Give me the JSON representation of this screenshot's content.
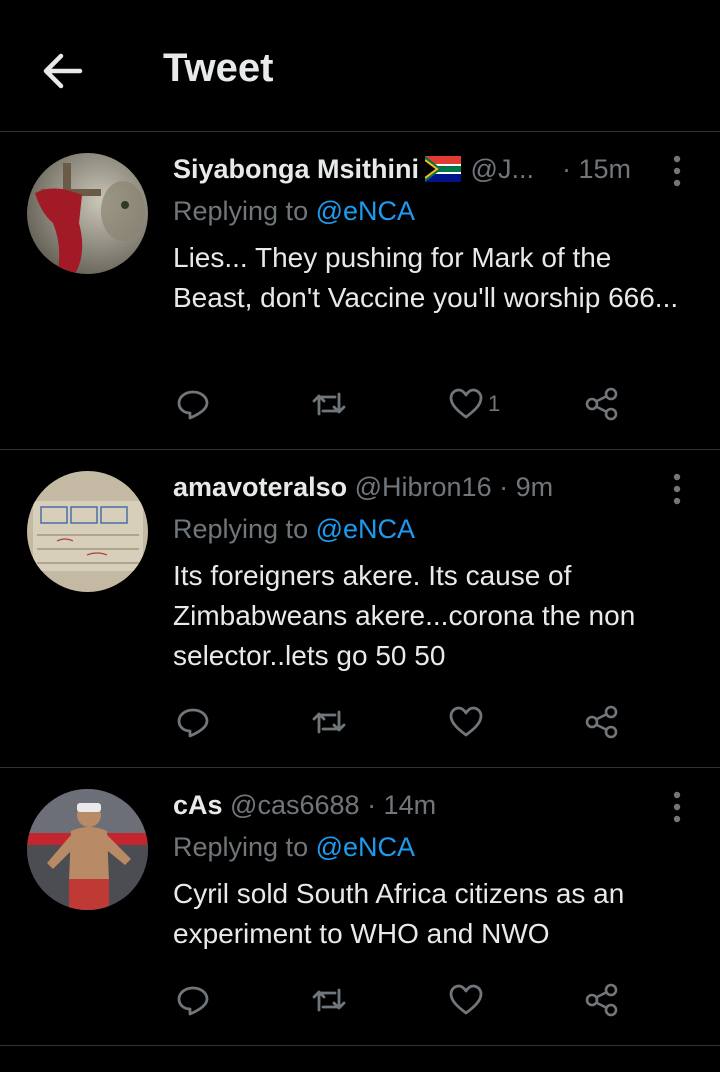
{
  "header": {
    "title": "Tweet",
    "back_icon": "arrow-left-icon"
  },
  "tweets": [
    {
      "name": "Siyabonga Msithini",
      "flag": "south-africa-flag-emoji",
      "handle": "@J...",
      "time": "· 15m",
      "replying_label": "Replying to ",
      "replying_to": "@eNCA",
      "text": "Lies... They pushing for Mark of the Beast, don't Vaccine you'll worship 666...",
      "likes": "1"
    },
    {
      "name": "amavoteralso",
      "handle": "@Hibron16",
      "time": "· 9m",
      "replying_label": "Replying to ",
      "replying_to": "@eNCA",
      "text": "Its foreigners akere. Its cause of Zimbabweans akere...corona the non selector..lets go 50 50",
      "likes": ""
    },
    {
      "name": "cAs",
      "handle": "@cas6688",
      "time": "· 14m",
      "replying_label": "Replying to ",
      "replying_to": "@eNCA",
      "text": "Cyril sold South Africa citizens as an experiment to WHO and NWO",
      "likes": ""
    }
  ],
  "colors": {
    "background": "#000000",
    "text": "#e7e9ea",
    "muted": "#71767b",
    "link": "#1d9bf0",
    "divider": "#2f3336"
  }
}
